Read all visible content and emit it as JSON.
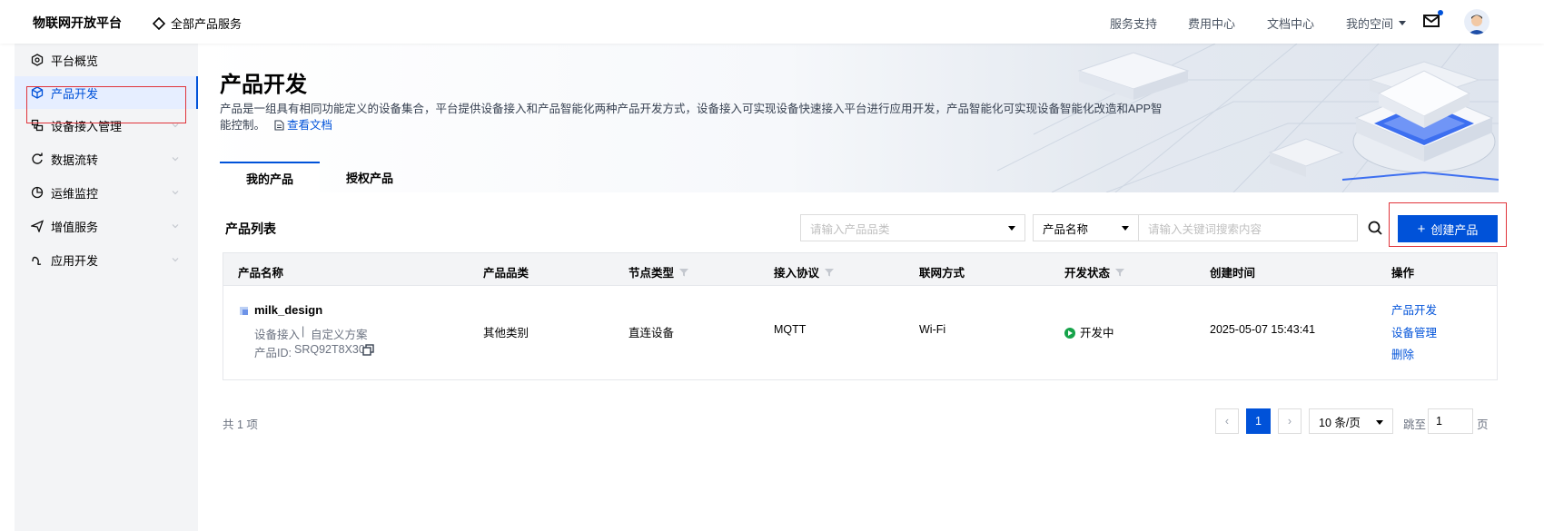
{
  "header": {
    "brand": "物联网开放平台",
    "all_services": "全部产品服务",
    "links": [
      "服务支持",
      "费用中心",
      "文档中心",
      "我的空间"
    ]
  },
  "sidebar": {
    "items": [
      {
        "label": "平台概览",
        "icon": "overview-icon"
      },
      {
        "label": "产品开发",
        "icon": "cube-icon",
        "active": true
      },
      {
        "label": "设备接入管理",
        "icon": "device-icon"
      },
      {
        "label": "数据流转",
        "icon": "flow-icon"
      },
      {
        "label": "运维监控",
        "icon": "monitor-icon"
      },
      {
        "label": "增值服务",
        "icon": "send-icon"
      },
      {
        "label": "应用开发",
        "icon": "app-icon"
      }
    ]
  },
  "hero": {
    "title": "产品开发",
    "description": "产品是一组具有相同功能定义的设备集合，平台提供设备接入和产品智能化两种产品开发方式，设备接入可实现设备快速接入平台进行应用开发，产品智能化可实现设备智能化改造和APP智能控制。",
    "doc_link": "查看文档"
  },
  "tabs": [
    "我的产品",
    "授权产品"
  ],
  "list": {
    "title": "产品列表",
    "category_placeholder": "请输入产品品类",
    "search_field": "产品名称",
    "keyword_placeholder": "请输入关键词搜索内容",
    "create_button": "创建产品"
  },
  "table": {
    "columns": [
      "产品名称",
      "产品品类",
      "节点类型",
      "接入协议",
      "联网方式",
      "开发状态",
      "创建时间",
      "操作"
    ],
    "rows": [
      {
        "name": "milk_design",
        "sub": "设备接入",
        "sep": "|",
        "scheme": "自定义方案",
        "id_label": "产品ID:",
        "id": "SRQ92T8X30",
        "category": "其他类别",
        "node_type": "直连设备",
        "protocol": "MQTT",
        "network": "Wi-Fi",
        "status": "开发中",
        "created": "2025-05-07 15:43:41",
        "actions": [
          "产品开发",
          "设备管理",
          "删除"
        ]
      }
    ]
  },
  "pagination": {
    "total": "共 1 项",
    "prev": "‹",
    "current": "1",
    "next": "›",
    "page_size": "10 条/页",
    "jump_label": "跳至",
    "jump_value": "1",
    "page_unit": "页"
  },
  "colors": {
    "accent": "#0052d9",
    "highlight_box": "#e0343b",
    "status_green": "#16a34a"
  }
}
